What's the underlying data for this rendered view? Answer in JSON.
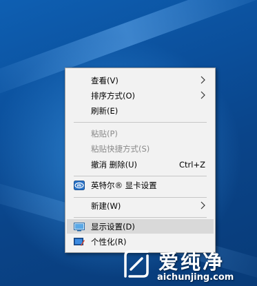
{
  "context_menu": {
    "items": [
      {
        "label": "查看(V)",
        "submenu": true,
        "enabled": true
      },
      {
        "label": "排序方式(O)",
        "submenu": true,
        "enabled": true
      },
      {
        "label": "刷新(E)",
        "enabled": true
      },
      {
        "label": "粘贴(P)",
        "enabled": false
      },
      {
        "label": "粘贴快捷方式(S)",
        "enabled": false
      },
      {
        "label": "撤消 删除(U)",
        "shortcut": "Ctrl+Z",
        "enabled": true
      },
      {
        "label": "英特尔® 显卡设置",
        "icon": "intel-graphics-icon",
        "enabled": true
      },
      {
        "label": "新建(W)",
        "submenu": true,
        "enabled": true
      },
      {
        "label": "显示设置(D)",
        "icon": "display-icon",
        "enabled": true,
        "highlighted": true
      },
      {
        "label": "个性化(R)",
        "icon": "personalize-icon",
        "enabled": true
      }
    ]
  },
  "watermark": {
    "brand": "爱纯净",
    "url": "aichunjing.com"
  },
  "colors": {
    "desktop_blue": "#0b4f9b",
    "menu_bg": "#f2f2f2",
    "highlight": "#d9d9d9",
    "disabled_text": "#8a8a8a"
  }
}
